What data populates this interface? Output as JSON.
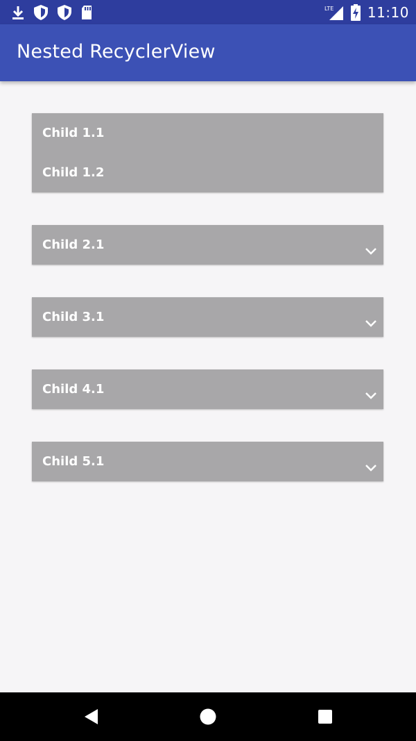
{
  "status_bar": {
    "icons_left": [
      "download-icon",
      "shield-icon",
      "shield-icon",
      "sd-card-icon"
    ],
    "network_label": "LTE",
    "time": "11:10"
  },
  "app_bar": {
    "title": "Nested RecyclerView"
  },
  "groups": [
    {
      "children": [
        "Child 1.1",
        "Child 1.2"
      ],
      "expanded": true
    },
    {
      "children": [
        "Child 2.1"
      ],
      "expanded": false
    },
    {
      "children": [
        "Child 3.1"
      ],
      "expanded": false
    },
    {
      "children": [
        "Child 4.1"
      ],
      "expanded": false
    },
    {
      "children": [
        "Child 5.1"
      ],
      "expanded": false
    }
  ],
  "nav_bar": {
    "buttons": [
      "back-icon",
      "home-icon",
      "recents-icon"
    ]
  },
  "colors": {
    "status_bar": "#2e3d9e",
    "app_bar": "#3c51b5",
    "background": "#f6f5f7",
    "card": "#a8a7a9",
    "text_on_card": "#ffffff"
  }
}
